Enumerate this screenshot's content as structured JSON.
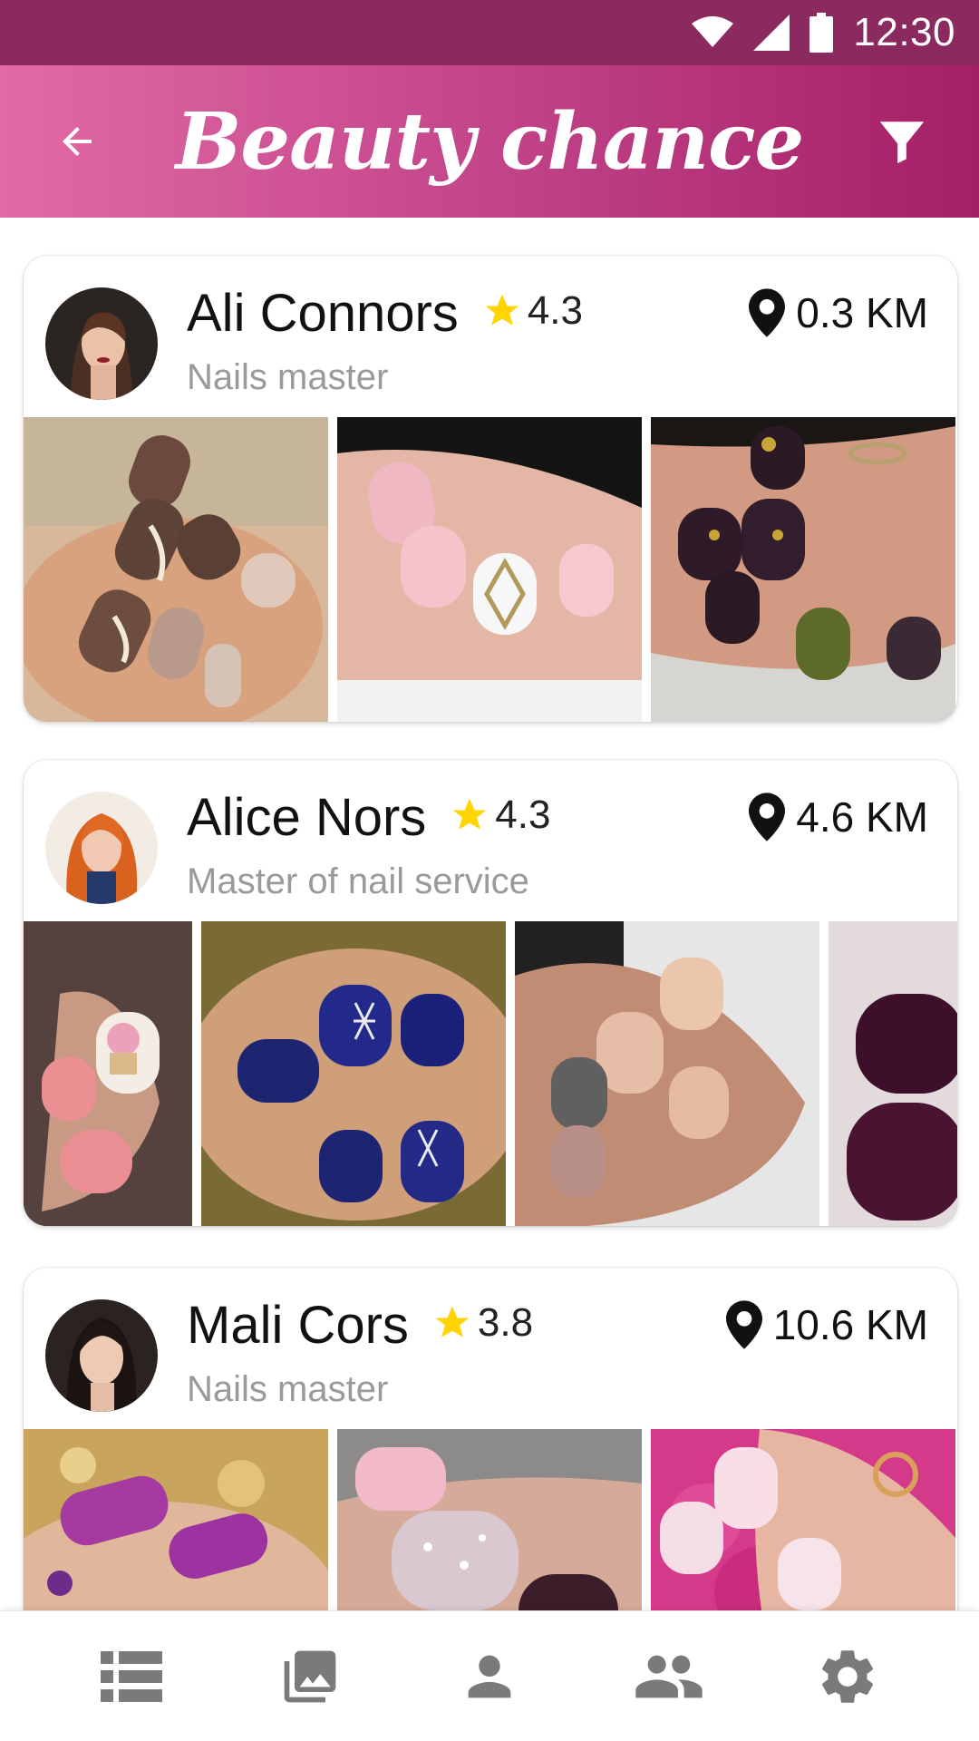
{
  "status_bar": {
    "time": "12:30"
  },
  "app_bar": {
    "title": "Beauty chance"
  },
  "colors": {
    "status_bar": "#8b2a5e",
    "accent_start": "#e26aa5",
    "accent_end": "#a41f66",
    "star": "#ffd400",
    "role_text": "#9a9a9a",
    "nav_icon": "#7a7a7a"
  },
  "masters": [
    {
      "name": "Ali Connors",
      "rating": "4.3",
      "role": "Nails master",
      "distance": "0.3 KM"
    },
    {
      "name": "Alice Nors",
      "rating": "4.3",
      "role": "Master of nail service",
      "distance": "4.6 KM"
    },
    {
      "name": "Mali Cors",
      "rating": "3.8",
      "role": "Nails master",
      "distance": "10.6 KM"
    }
  ],
  "bottom_nav": {
    "items": [
      {
        "icon": "list-icon"
      },
      {
        "icon": "gallery-icon"
      },
      {
        "icon": "person-icon"
      },
      {
        "icon": "people-icon"
      },
      {
        "icon": "settings-icon"
      }
    ]
  }
}
